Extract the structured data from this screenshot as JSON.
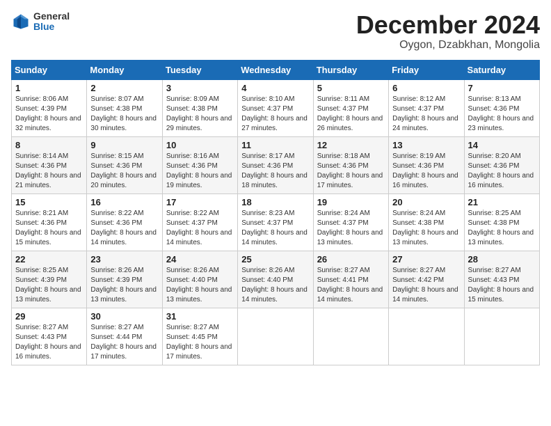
{
  "logo": {
    "general": "General",
    "blue": "Blue"
  },
  "title": "December 2024",
  "location": "Oygon, Dzabkhan, Mongolia",
  "weekdays": [
    "Sunday",
    "Monday",
    "Tuesday",
    "Wednesday",
    "Thursday",
    "Friday",
    "Saturday"
  ],
  "weeks": [
    [
      {
        "day": "1",
        "sunrise": "Sunrise: 8:06 AM",
        "sunset": "Sunset: 4:39 PM",
        "daylight": "Daylight: 8 hours and 32 minutes."
      },
      {
        "day": "2",
        "sunrise": "Sunrise: 8:07 AM",
        "sunset": "Sunset: 4:38 PM",
        "daylight": "Daylight: 8 hours and 30 minutes."
      },
      {
        "day": "3",
        "sunrise": "Sunrise: 8:09 AM",
        "sunset": "Sunset: 4:38 PM",
        "daylight": "Daylight: 8 hours and 29 minutes."
      },
      {
        "day": "4",
        "sunrise": "Sunrise: 8:10 AM",
        "sunset": "Sunset: 4:37 PM",
        "daylight": "Daylight: 8 hours and 27 minutes."
      },
      {
        "day": "5",
        "sunrise": "Sunrise: 8:11 AM",
        "sunset": "Sunset: 4:37 PM",
        "daylight": "Daylight: 8 hours and 26 minutes."
      },
      {
        "day": "6",
        "sunrise": "Sunrise: 8:12 AM",
        "sunset": "Sunset: 4:37 PM",
        "daylight": "Daylight: 8 hours and 24 minutes."
      },
      {
        "day": "7",
        "sunrise": "Sunrise: 8:13 AM",
        "sunset": "Sunset: 4:36 PM",
        "daylight": "Daylight: 8 hours and 23 minutes."
      }
    ],
    [
      {
        "day": "8",
        "sunrise": "Sunrise: 8:14 AM",
        "sunset": "Sunset: 4:36 PM",
        "daylight": "Daylight: 8 hours and 21 minutes."
      },
      {
        "day": "9",
        "sunrise": "Sunrise: 8:15 AM",
        "sunset": "Sunset: 4:36 PM",
        "daylight": "Daylight: 8 hours and 20 minutes."
      },
      {
        "day": "10",
        "sunrise": "Sunrise: 8:16 AM",
        "sunset": "Sunset: 4:36 PM",
        "daylight": "Daylight: 8 hours and 19 minutes."
      },
      {
        "day": "11",
        "sunrise": "Sunrise: 8:17 AM",
        "sunset": "Sunset: 4:36 PM",
        "daylight": "Daylight: 8 hours and 18 minutes."
      },
      {
        "day": "12",
        "sunrise": "Sunrise: 8:18 AM",
        "sunset": "Sunset: 4:36 PM",
        "daylight": "Daylight: 8 hours and 17 minutes."
      },
      {
        "day": "13",
        "sunrise": "Sunrise: 8:19 AM",
        "sunset": "Sunset: 4:36 PM",
        "daylight": "Daylight: 8 hours and 16 minutes."
      },
      {
        "day": "14",
        "sunrise": "Sunrise: 8:20 AM",
        "sunset": "Sunset: 4:36 PM",
        "daylight": "Daylight: 8 hours and 16 minutes."
      }
    ],
    [
      {
        "day": "15",
        "sunrise": "Sunrise: 8:21 AM",
        "sunset": "Sunset: 4:36 PM",
        "daylight": "Daylight: 8 hours and 15 minutes."
      },
      {
        "day": "16",
        "sunrise": "Sunrise: 8:22 AM",
        "sunset": "Sunset: 4:36 PM",
        "daylight": "Daylight: 8 hours and 14 minutes."
      },
      {
        "day": "17",
        "sunrise": "Sunrise: 8:22 AM",
        "sunset": "Sunset: 4:37 PM",
        "daylight": "Daylight: 8 hours and 14 minutes."
      },
      {
        "day": "18",
        "sunrise": "Sunrise: 8:23 AM",
        "sunset": "Sunset: 4:37 PM",
        "daylight": "Daylight: 8 hours and 14 minutes."
      },
      {
        "day": "19",
        "sunrise": "Sunrise: 8:24 AM",
        "sunset": "Sunset: 4:37 PM",
        "daylight": "Daylight: 8 hours and 13 minutes."
      },
      {
        "day": "20",
        "sunrise": "Sunrise: 8:24 AM",
        "sunset": "Sunset: 4:38 PM",
        "daylight": "Daylight: 8 hours and 13 minutes."
      },
      {
        "day": "21",
        "sunrise": "Sunrise: 8:25 AM",
        "sunset": "Sunset: 4:38 PM",
        "daylight": "Daylight: 8 hours and 13 minutes."
      }
    ],
    [
      {
        "day": "22",
        "sunrise": "Sunrise: 8:25 AM",
        "sunset": "Sunset: 4:39 PM",
        "daylight": "Daylight: 8 hours and 13 minutes."
      },
      {
        "day": "23",
        "sunrise": "Sunrise: 8:26 AM",
        "sunset": "Sunset: 4:39 PM",
        "daylight": "Daylight: 8 hours and 13 minutes."
      },
      {
        "day": "24",
        "sunrise": "Sunrise: 8:26 AM",
        "sunset": "Sunset: 4:40 PM",
        "daylight": "Daylight: 8 hours and 13 minutes."
      },
      {
        "day": "25",
        "sunrise": "Sunrise: 8:26 AM",
        "sunset": "Sunset: 4:40 PM",
        "daylight": "Daylight: 8 hours and 14 minutes."
      },
      {
        "day": "26",
        "sunrise": "Sunrise: 8:27 AM",
        "sunset": "Sunset: 4:41 PM",
        "daylight": "Daylight: 8 hours and 14 minutes."
      },
      {
        "day": "27",
        "sunrise": "Sunrise: 8:27 AM",
        "sunset": "Sunset: 4:42 PM",
        "daylight": "Daylight: 8 hours and 14 minutes."
      },
      {
        "day": "28",
        "sunrise": "Sunrise: 8:27 AM",
        "sunset": "Sunset: 4:43 PM",
        "daylight": "Daylight: 8 hours and 15 minutes."
      }
    ],
    [
      {
        "day": "29",
        "sunrise": "Sunrise: 8:27 AM",
        "sunset": "Sunset: 4:43 PM",
        "daylight": "Daylight: 8 hours and 16 minutes."
      },
      {
        "day": "30",
        "sunrise": "Sunrise: 8:27 AM",
        "sunset": "Sunset: 4:44 PM",
        "daylight": "Daylight: 8 hours and 17 minutes."
      },
      {
        "day": "31",
        "sunrise": "Sunrise: 8:27 AM",
        "sunset": "Sunset: 4:45 PM",
        "daylight": "Daylight: 8 hours and 17 minutes."
      },
      null,
      null,
      null,
      null
    ]
  ]
}
